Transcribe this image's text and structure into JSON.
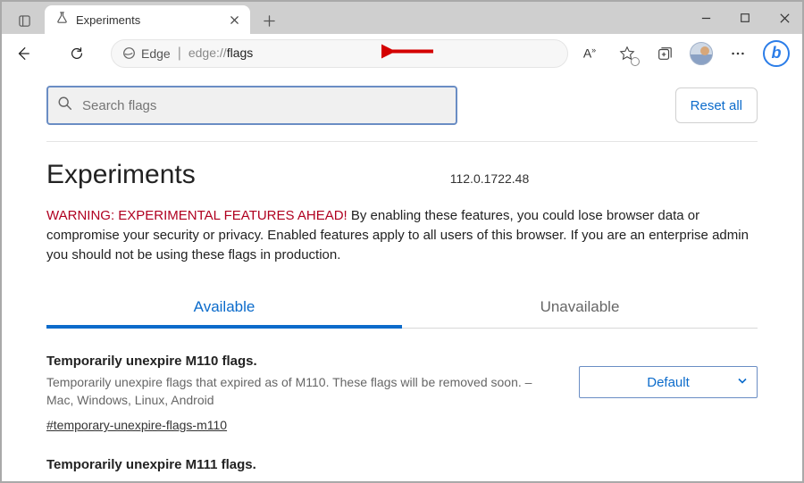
{
  "titlebar": {
    "tab_label": "Experiments"
  },
  "toolbar": {
    "prefix": "Edge",
    "url_gray": "edge://",
    "url_strong": "flags"
  },
  "search": {
    "placeholder": "Search flags",
    "reset_label": "Reset all"
  },
  "page": {
    "title": "Experiments",
    "version": "112.0.1722.48"
  },
  "warning": {
    "heading": "WARNING: EXPERIMENTAL FEATURES AHEAD!",
    "body": " By enabling these features, you could lose browser data or compromise your security or privacy. Enabled features apply to all users of this browser. If you are an enterprise admin you should not be using these flags in production."
  },
  "tabs": {
    "available": "Available",
    "unavailable": "Unavailable"
  },
  "flags": [
    {
      "title": "Temporarily unexpire M110 flags.",
      "desc": "Temporarily unexpire flags that expired as of M110. These flags will be removed soon. – Mac, Windows, Linux, Android",
      "anchor": "#temporary-unexpire-flags-m110",
      "select_value": "Default"
    },
    {
      "title": "Temporarily unexpire M111 flags."
    }
  ]
}
